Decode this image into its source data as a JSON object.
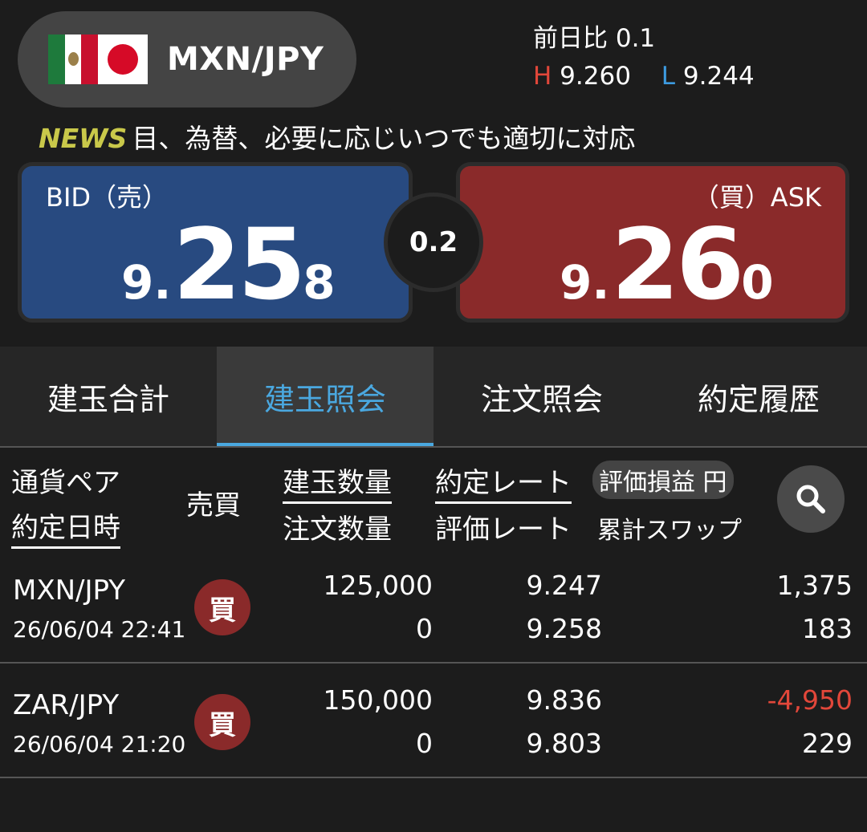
{
  "header": {
    "pair": "MXN/JPY",
    "prev_diff": "前日比 0.1",
    "high_letter": "H",
    "high_value": "9.260",
    "low_letter": "L",
    "low_value": "9.244",
    "flags": [
      "mexico-flag-icon",
      "japan-flag-icon"
    ]
  },
  "news": {
    "tag": "NEWS",
    "text": "目、為替、必要に応じいつでも適切に対応"
  },
  "bid": {
    "label": "BID（売）",
    "prefix": "9",
    "dot": ".",
    "big": "25",
    "suffix": "8"
  },
  "ask": {
    "label": "（買）ASK",
    "prefix": "9",
    "dot": ".",
    "big": "26",
    "suffix": "0"
  },
  "spread": "0.2",
  "tabs": [
    {
      "label": "建玉合計",
      "active": false
    },
    {
      "label": "建玉照会",
      "active": true
    },
    {
      "label": "注文照会",
      "active": false
    },
    {
      "label": "約定履歴",
      "active": false
    }
  ],
  "columns": {
    "pair": "通貨ペア",
    "date": "約定日時",
    "side": "売買",
    "qty": "建玉数量",
    "order_qty": "注文数量",
    "rate": "約定レート",
    "eval_rate": "評価レート",
    "pl": "評価損益 円",
    "swap": "累計スワップ"
  },
  "rows": [
    {
      "pair": "MXN/JPY",
      "datetime": "26/06/04 22:41",
      "side": "買",
      "qty": "125,000",
      "order_qty": "0",
      "rate": "9.247",
      "eval_rate": "9.258",
      "pl": "1,375",
      "swap": "183"
    },
    {
      "pair": "ZAR/JPY",
      "datetime": "26/06/04 21:20",
      "side": "買",
      "qty": "150,000",
      "order_qty": "0",
      "rate": "9.836",
      "eval_rate": "9.803",
      "pl": "-4,950",
      "swap": "229"
    }
  ],
  "colors": {
    "bid": "#284a80",
    "ask": "#8a2a2a",
    "accent": "#4aa8e0",
    "negative": "#e2473a",
    "news_tag": "#c9c84a"
  }
}
